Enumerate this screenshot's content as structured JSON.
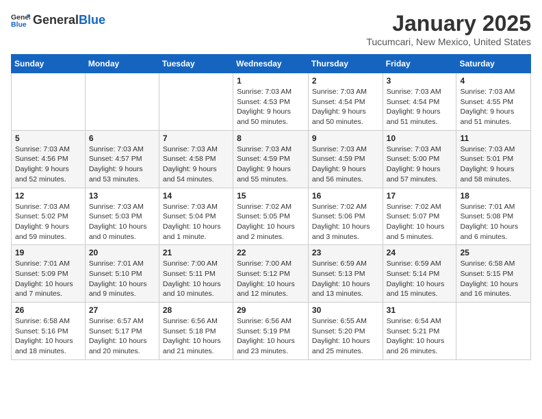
{
  "header": {
    "logo_general": "General",
    "logo_blue": "Blue",
    "title": "January 2025",
    "subtitle": "Tucumcari, New Mexico, United States"
  },
  "days_of_week": [
    "Sunday",
    "Monday",
    "Tuesday",
    "Wednesday",
    "Thursday",
    "Friday",
    "Saturday"
  ],
  "weeks": [
    [
      {
        "num": "",
        "info": ""
      },
      {
        "num": "",
        "info": ""
      },
      {
        "num": "",
        "info": ""
      },
      {
        "num": "1",
        "info": "Sunrise: 7:03 AM\nSunset: 4:53 PM\nDaylight: 9 hours\nand 50 minutes."
      },
      {
        "num": "2",
        "info": "Sunrise: 7:03 AM\nSunset: 4:54 PM\nDaylight: 9 hours\nand 50 minutes."
      },
      {
        "num": "3",
        "info": "Sunrise: 7:03 AM\nSunset: 4:54 PM\nDaylight: 9 hours\nand 51 minutes."
      },
      {
        "num": "4",
        "info": "Sunrise: 7:03 AM\nSunset: 4:55 PM\nDaylight: 9 hours\nand 51 minutes."
      }
    ],
    [
      {
        "num": "5",
        "info": "Sunrise: 7:03 AM\nSunset: 4:56 PM\nDaylight: 9 hours\nand 52 minutes."
      },
      {
        "num": "6",
        "info": "Sunrise: 7:03 AM\nSunset: 4:57 PM\nDaylight: 9 hours\nand 53 minutes."
      },
      {
        "num": "7",
        "info": "Sunrise: 7:03 AM\nSunset: 4:58 PM\nDaylight: 9 hours\nand 54 minutes."
      },
      {
        "num": "8",
        "info": "Sunrise: 7:03 AM\nSunset: 4:59 PM\nDaylight: 9 hours\nand 55 minutes."
      },
      {
        "num": "9",
        "info": "Sunrise: 7:03 AM\nSunset: 4:59 PM\nDaylight: 9 hours\nand 56 minutes."
      },
      {
        "num": "10",
        "info": "Sunrise: 7:03 AM\nSunset: 5:00 PM\nDaylight: 9 hours\nand 57 minutes."
      },
      {
        "num": "11",
        "info": "Sunrise: 7:03 AM\nSunset: 5:01 PM\nDaylight: 9 hours\nand 58 minutes."
      }
    ],
    [
      {
        "num": "12",
        "info": "Sunrise: 7:03 AM\nSunset: 5:02 PM\nDaylight: 9 hours\nand 59 minutes."
      },
      {
        "num": "13",
        "info": "Sunrise: 7:03 AM\nSunset: 5:03 PM\nDaylight: 10 hours\nand 0 minutes."
      },
      {
        "num": "14",
        "info": "Sunrise: 7:03 AM\nSunset: 5:04 PM\nDaylight: 10 hours\nand 1 minute."
      },
      {
        "num": "15",
        "info": "Sunrise: 7:02 AM\nSunset: 5:05 PM\nDaylight: 10 hours\nand 2 minutes."
      },
      {
        "num": "16",
        "info": "Sunrise: 7:02 AM\nSunset: 5:06 PM\nDaylight: 10 hours\nand 3 minutes."
      },
      {
        "num": "17",
        "info": "Sunrise: 7:02 AM\nSunset: 5:07 PM\nDaylight: 10 hours\nand 5 minutes."
      },
      {
        "num": "18",
        "info": "Sunrise: 7:01 AM\nSunset: 5:08 PM\nDaylight: 10 hours\nand 6 minutes."
      }
    ],
    [
      {
        "num": "19",
        "info": "Sunrise: 7:01 AM\nSunset: 5:09 PM\nDaylight: 10 hours\nand 7 minutes."
      },
      {
        "num": "20",
        "info": "Sunrise: 7:01 AM\nSunset: 5:10 PM\nDaylight: 10 hours\nand 9 minutes."
      },
      {
        "num": "21",
        "info": "Sunrise: 7:00 AM\nSunset: 5:11 PM\nDaylight: 10 hours\nand 10 minutes."
      },
      {
        "num": "22",
        "info": "Sunrise: 7:00 AM\nSunset: 5:12 PM\nDaylight: 10 hours\nand 12 minutes."
      },
      {
        "num": "23",
        "info": "Sunrise: 6:59 AM\nSunset: 5:13 PM\nDaylight: 10 hours\nand 13 minutes."
      },
      {
        "num": "24",
        "info": "Sunrise: 6:59 AM\nSunset: 5:14 PM\nDaylight: 10 hours\nand 15 minutes."
      },
      {
        "num": "25",
        "info": "Sunrise: 6:58 AM\nSunset: 5:15 PM\nDaylight: 10 hours\nand 16 minutes."
      }
    ],
    [
      {
        "num": "26",
        "info": "Sunrise: 6:58 AM\nSunset: 5:16 PM\nDaylight: 10 hours\nand 18 minutes."
      },
      {
        "num": "27",
        "info": "Sunrise: 6:57 AM\nSunset: 5:17 PM\nDaylight: 10 hours\nand 20 minutes."
      },
      {
        "num": "28",
        "info": "Sunrise: 6:56 AM\nSunset: 5:18 PM\nDaylight: 10 hours\nand 21 minutes."
      },
      {
        "num": "29",
        "info": "Sunrise: 6:56 AM\nSunset: 5:19 PM\nDaylight: 10 hours\nand 23 minutes."
      },
      {
        "num": "30",
        "info": "Sunrise: 6:55 AM\nSunset: 5:20 PM\nDaylight: 10 hours\nand 25 minutes."
      },
      {
        "num": "31",
        "info": "Sunrise: 6:54 AM\nSunset: 5:21 PM\nDaylight: 10 hours\nand 26 minutes."
      },
      {
        "num": "",
        "info": ""
      }
    ]
  ]
}
